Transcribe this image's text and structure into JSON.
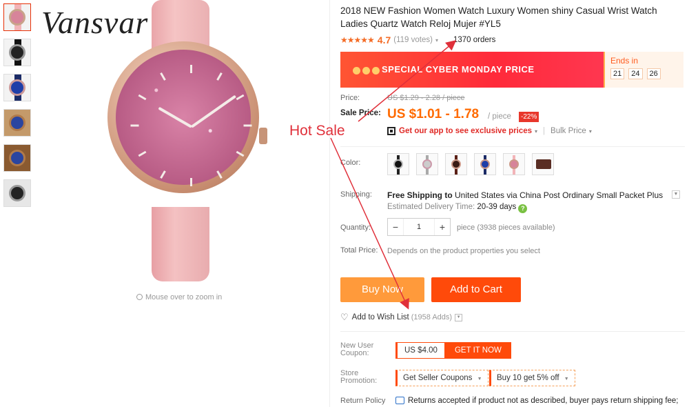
{
  "brand": "Vansvar",
  "zoom_hint": "Mouse over to zoom in",
  "annotation": "Hot Sale",
  "product": {
    "title": "2018 NEW Fashion Women Watch Luxury Women shiny Casual Wrist Watch Ladies Quartz Watch Reloj Mujer #YL5",
    "stars": "★★★★★",
    "rating": "4.7",
    "votes": "(119 votes)",
    "orders": "1370 orders"
  },
  "banner": {
    "text": "SPECIAL CYBER MONDAY PRICE",
    "ends_label": "Ends in",
    "timer": [
      "21",
      "24",
      "26"
    ]
  },
  "price": {
    "label": "Price:",
    "original": "US $1.29 - 2.28 / piece",
    "sale_label": "Sale Price:",
    "sale": "US $1.01 - 1.78",
    "unit": "/ piece",
    "discount": "-22%",
    "app_link": "Get our app to see exclusive prices",
    "bulk": "Bulk Price"
  },
  "color": {
    "label": "Color:",
    "options": [
      "black",
      "gray",
      "brown",
      "blue",
      "pink",
      "box"
    ]
  },
  "shipping": {
    "label": "Shipping:",
    "free": "Free Shipping to",
    "detail": "United States via China Post Ordinary Small Packet Plus",
    "eta_label": "Estimated Delivery Time:",
    "eta_value": "20-39",
    "eta_unit": "days",
    "help": "?"
  },
  "quantity": {
    "label": "Quantity:",
    "value": "1",
    "minus": "−",
    "plus": "+",
    "available": "piece (3938 pieces available)"
  },
  "total": {
    "label": "Total Price:",
    "value": "Depends on the product properties you select"
  },
  "actions": {
    "buy_now": "Buy Now",
    "add_to_cart": "Add to Cart",
    "wish_list": "Add to Wish List",
    "wish_count": "(1958 Adds)"
  },
  "coupon": {
    "label": "New User Coupon:",
    "amount": "US $4.00",
    "get": "GET IT NOW"
  },
  "promotion": {
    "label": "Store Promotion:",
    "seller_coupons": "Get Seller Coupons",
    "buy_offer": "Buy 10 get 5% off"
  },
  "return_policy": {
    "label": "Return Policy",
    "text": "Returns accepted if product not as described, buyer pays return shipping fee;"
  },
  "colors": {
    "accent": "#ff4a0a",
    "price": "#ff6a00",
    "annotation": "#e0303a"
  }
}
